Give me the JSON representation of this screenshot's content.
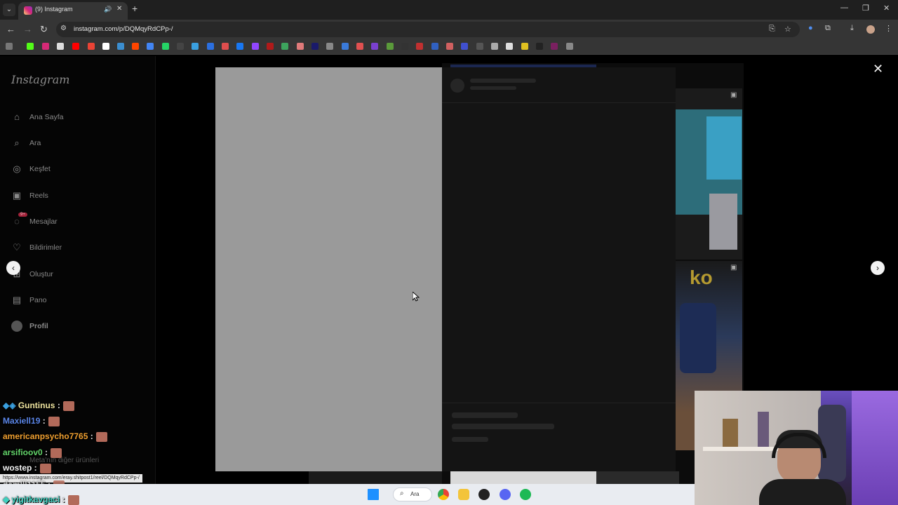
{
  "browser": {
    "tab_title": "(9) Instagram",
    "url": "instagram.com/p/DQMqyRdCPp-/",
    "status_url": "https://www.instagram.com/eray.shitpost1/reel/DQMqyRdCPp-/"
  },
  "instagram": {
    "logo": "Instagram",
    "nav": [
      {
        "label": "Ana Sayfa",
        "icon": "home-icon"
      },
      {
        "label": "Ara",
        "icon": "search-icon"
      },
      {
        "label": "Keşfet",
        "icon": "compass-icon"
      },
      {
        "label": "Reels",
        "icon": "reels-icon"
      },
      {
        "label": "Mesajlar",
        "icon": "messenger-icon",
        "badge": "9+"
      },
      {
        "label": "Bildirimler",
        "icon": "heart-icon"
      },
      {
        "label": "Oluştur",
        "icon": "plus-icon"
      },
      {
        "label": "Pano",
        "icon": "dashboard-icon"
      },
      {
        "label": "Profil",
        "icon": "avatar"
      }
    ],
    "footer_text": "Meta'nın diğer ürünleri"
  },
  "chat": [
    {
      "user": "Guntinus",
      "sep": " :",
      "color": "#f0e5a0"
    },
    {
      "user": "Maxiell19",
      "sep": " :",
      "color": "#5b86e8"
    },
    {
      "user": "americanpsycho7765",
      "sep": " :",
      "color": "#f0a030"
    },
    {
      "user": "arsifioov0",
      "sep": " :",
      "color": "#63d46a"
    },
    {
      "user": "wostep",
      "sep": " :",
      "color": "#f2f2f2"
    },
    {
      "user": "damlll1155",
      "sep": " :",
      "color": "#e0e0e0"
    },
    {
      "user": "yigitkavgaci",
      "sep": " :",
      "color": "#3fd1c0"
    }
  ],
  "taskbar": {
    "search_label": "Ara"
  },
  "colors": {
    "modal_media": "#9a9a9a",
    "modal_panel": "#141414",
    "taskbar": "#e9ecf1"
  }
}
